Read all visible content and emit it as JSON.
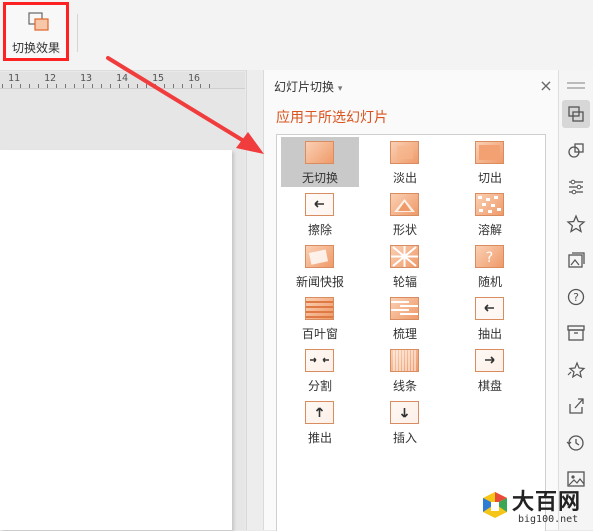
{
  "toolbar": {
    "transition_effects_label": "切换效果"
  },
  "ruler": {
    "ticks": [
      "11",
      "12",
      "13",
      "14",
      "15",
      "16"
    ]
  },
  "panel": {
    "title": "幻灯片切换",
    "title_caret": "▾",
    "close_label": "×",
    "apply_heading": "应用于所选幻灯片",
    "effects": [
      {
        "label": "无切换",
        "icon": "none-icon",
        "selected": true
      },
      {
        "label": "淡出",
        "icon": "fade-icon"
      },
      {
        "label": "切出",
        "icon": "cut-icon"
      },
      {
        "label": "擦除",
        "icon": "wipe-icon"
      },
      {
        "label": "形状",
        "icon": "shape-icon"
      },
      {
        "label": "溶解",
        "icon": "dissolve-icon"
      },
      {
        "label": "新闻快报",
        "icon": "newsflash-icon"
      },
      {
        "label": "轮辐",
        "icon": "wheel-icon"
      },
      {
        "label": "随机",
        "icon": "random-icon"
      },
      {
        "label": "百叶窗",
        "icon": "blinds-icon"
      },
      {
        "label": "梳理",
        "icon": "comb-icon"
      },
      {
        "label": "抽出",
        "icon": "pull-icon"
      },
      {
        "label": "分割",
        "icon": "split-icon"
      },
      {
        "label": "线条",
        "icon": "lines-icon"
      },
      {
        "label": "棋盘",
        "icon": "checkerboard-icon"
      },
      {
        "label": "推出",
        "icon": "push-icon"
      },
      {
        "label": "插入",
        "icon": "insert-icon"
      }
    ]
  },
  "sidebar": {
    "icons": [
      "slide-transition-icon",
      "shapes-icon",
      "properties-icon",
      "star-icon",
      "gallery-icon",
      "help-icon",
      "archive-icon",
      "animation-icon",
      "share-icon",
      "history-icon",
      "image-icon"
    ]
  },
  "watermark": {
    "text": "大百网",
    "url": "big100.net"
  },
  "colors": {
    "accent": "#d9541e",
    "highlight": "#ff2222",
    "arrow": "#f03c3c"
  }
}
